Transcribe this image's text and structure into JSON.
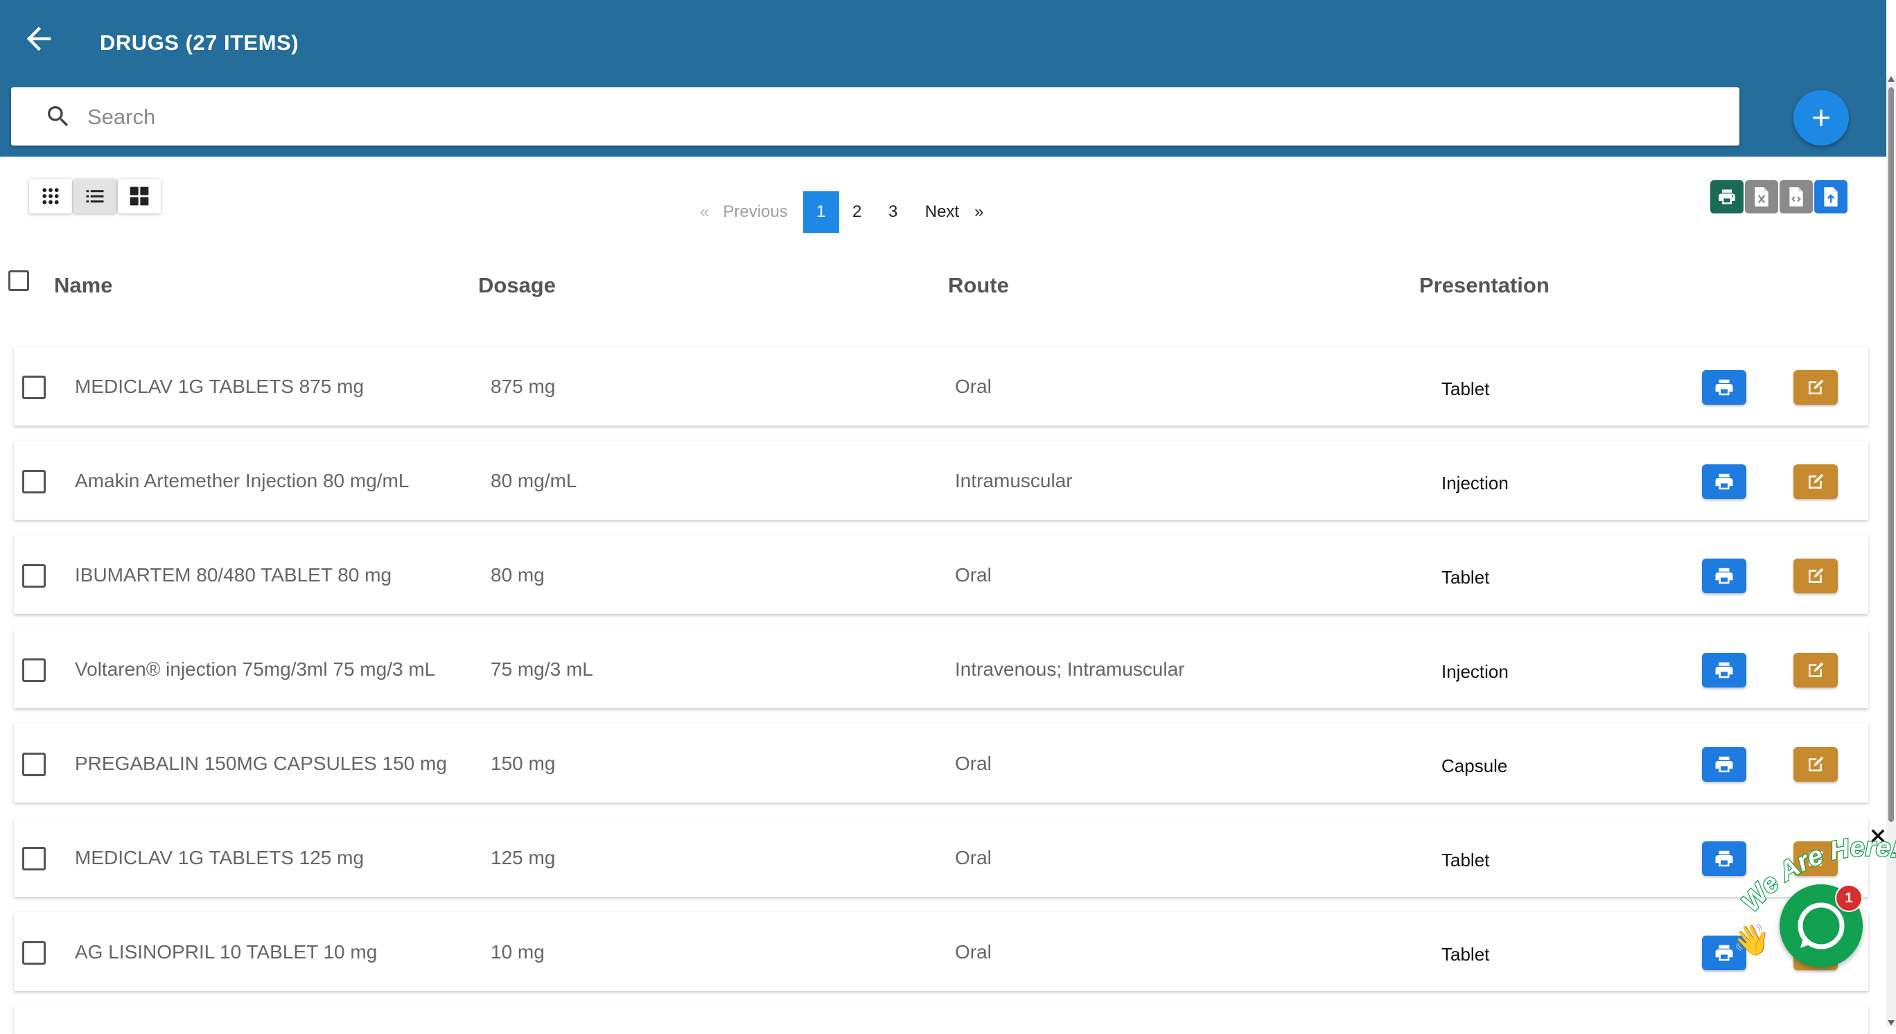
{
  "header": {
    "title": "DRUGS (27 ITEMS)",
    "search_placeholder": "Search",
    "search_value": ""
  },
  "pagination": {
    "prev_arrow": "«",
    "prev_label": "Previous",
    "pages": [
      "1",
      "2",
      "3"
    ],
    "current_page": "1",
    "next_label": "Next",
    "next_arrow": "»"
  },
  "columns": {
    "name": "Name",
    "dosage": "Dosage",
    "route": "Route",
    "presentation": "Presentation"
  },
  "rows": [
    {
      "name": "MEDICLAV 1G TABLETS 875 mg",
      "dosage": "875 mg",
      "route": "Oral",
      "presentation": "Tablet"
    },
    {
      "name": "Amakin Artemether Injection 80 mg/mL",
      "dosage": "80 mg/mL",
      "route": "Intramuscular",
      "presentation": "Injection"
    },
    {
      "name": "IBUMARTEM 80/480 TABLET 80 mg",
      "dosage": "80 mg",
      "route": "Oral",
      "presentation": "Tablet"
    },
    {
      "name": "Voltaren® injection 75mg/3ml 75 mg/3 mL",
      "dosage": "75 mg/3 mL",
      "route": "Intravenous; Intramuscular",
      "presentation": "Injection"
    },
    {
      "name": "PREGABALIN 150MG CAPSULES 150 mg",
      "dosage": "150 mg",
      "route": "Oral",
      "presentation": "Capsule"
    },
    {
      "name": "MEDICLAV 1G TABLETS 125 mg",
      "dosage": "125 mg",
      "route": "Oral",
      "presentation": "Tablet"
    },
    {
      "name": "AG LISINOPRIL 10 TABLET 10 mg",
      "dosage": "10 mg",
      "route": "Oral",
      "presentation": "Tablet"
    }
  ],
  "chat": {
    "tagline": "We Are Here!",
    "unread_count": "1"
  },
  "icons": {
    "back": "arrow-left-icon",
    "search": "search-icon",
    "add": "plus-icon",
    "view_grid_small": "grid-dots-icon",
    "view_list": "list-icon",
    "view_grid_large": "grid-large-icon",
    "export_print": "printer-icon",
    "export_excel": "excel-file-icon",
    "export_code": "code-file-icon",
    "export_upload": "file-upload-icon",
    "row_print": "printer-icon",
    "row_edit": "edit-icon",
    "chat": "chat-bubble-icon",
    "close": "close-icon"
  },
  "colors": {
    "header_bg": "#256d9a",
    "primary": "#1e88e5",
    "print_btn": "#1e7be0",
    "edit_btn": "#c88a2e",
    "export_print": "#1a6b56",
    "export_grey": "#8a8a8a",
    "chat_bg": "#12a150"
  }
}
